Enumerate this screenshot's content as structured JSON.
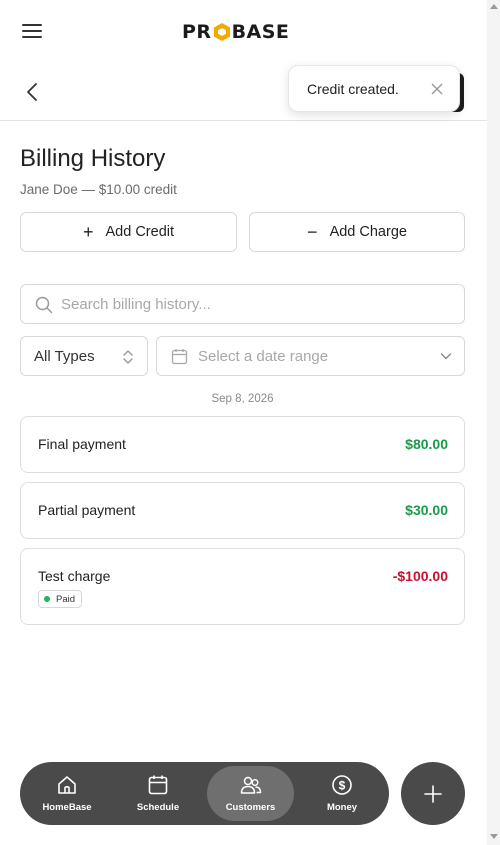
{
  "header": {
    "logo_text_left": "PR",
    "logo_text_right": "BASE",
    "menu_icon": "hamburger-icon"
  },
  "nav": {
    "back_icon": "chevron-left-icon"
  },
  "toast": {
    "message": "Credit created.",
    "close_icon": "close-icon"
  },
  "page": {
    "title": "Billing History",
    "subtitle": "Jane Doe — $10.00 credit"
  },
  "actions": {
    "add_credit": "Add Credit",
    "add_credit_symbol": "+",
    "add_charge": "Add Charge",
    "add_charge_symbol": "−"
  },
  "search": {
    "placeholder": "Search billing history...",
    "value": ""
  },
  "filters": {
    "type_value": "All Types",
    "date_placeholder": "Select a date range"
  },
  "date_group": "Sep 8, 2026",
  "transactions": [
    {
      "name": "Final payment",
      "amount": "$80.00",
      "kind": "positive"
    },
    {
      "name": "Partial payment",
      "amount": "$30.00",
      "kind": "positive"
    },
    {
      "name": "Test charge",
      "amount": "-$100.00",
      "kind": "negative",
      "badge": "Paid"
    }
  ],
  "bottom_nav": {
    "items": [
      {
        "label": "HomeBase",
        "icon": "home-icon"
      },
      {
        "label": "Schedule",
        "icon": "calendar-icon"
      },
      {
        "label": "Customers",
        "icon": "users-icon",
        "active": true
      },
      {
        "label": "Money",
        "icon": "dollar-icon"
      }
    ],
    "fab_icon": "plus-icon"
  },
  "colors": {
    "positive": "#1a9a4b",
    "negative": "#c8102e",
    "logo_accent": "#f5a800",
    "nav_bg": "#4a4a4a"
  }
}
